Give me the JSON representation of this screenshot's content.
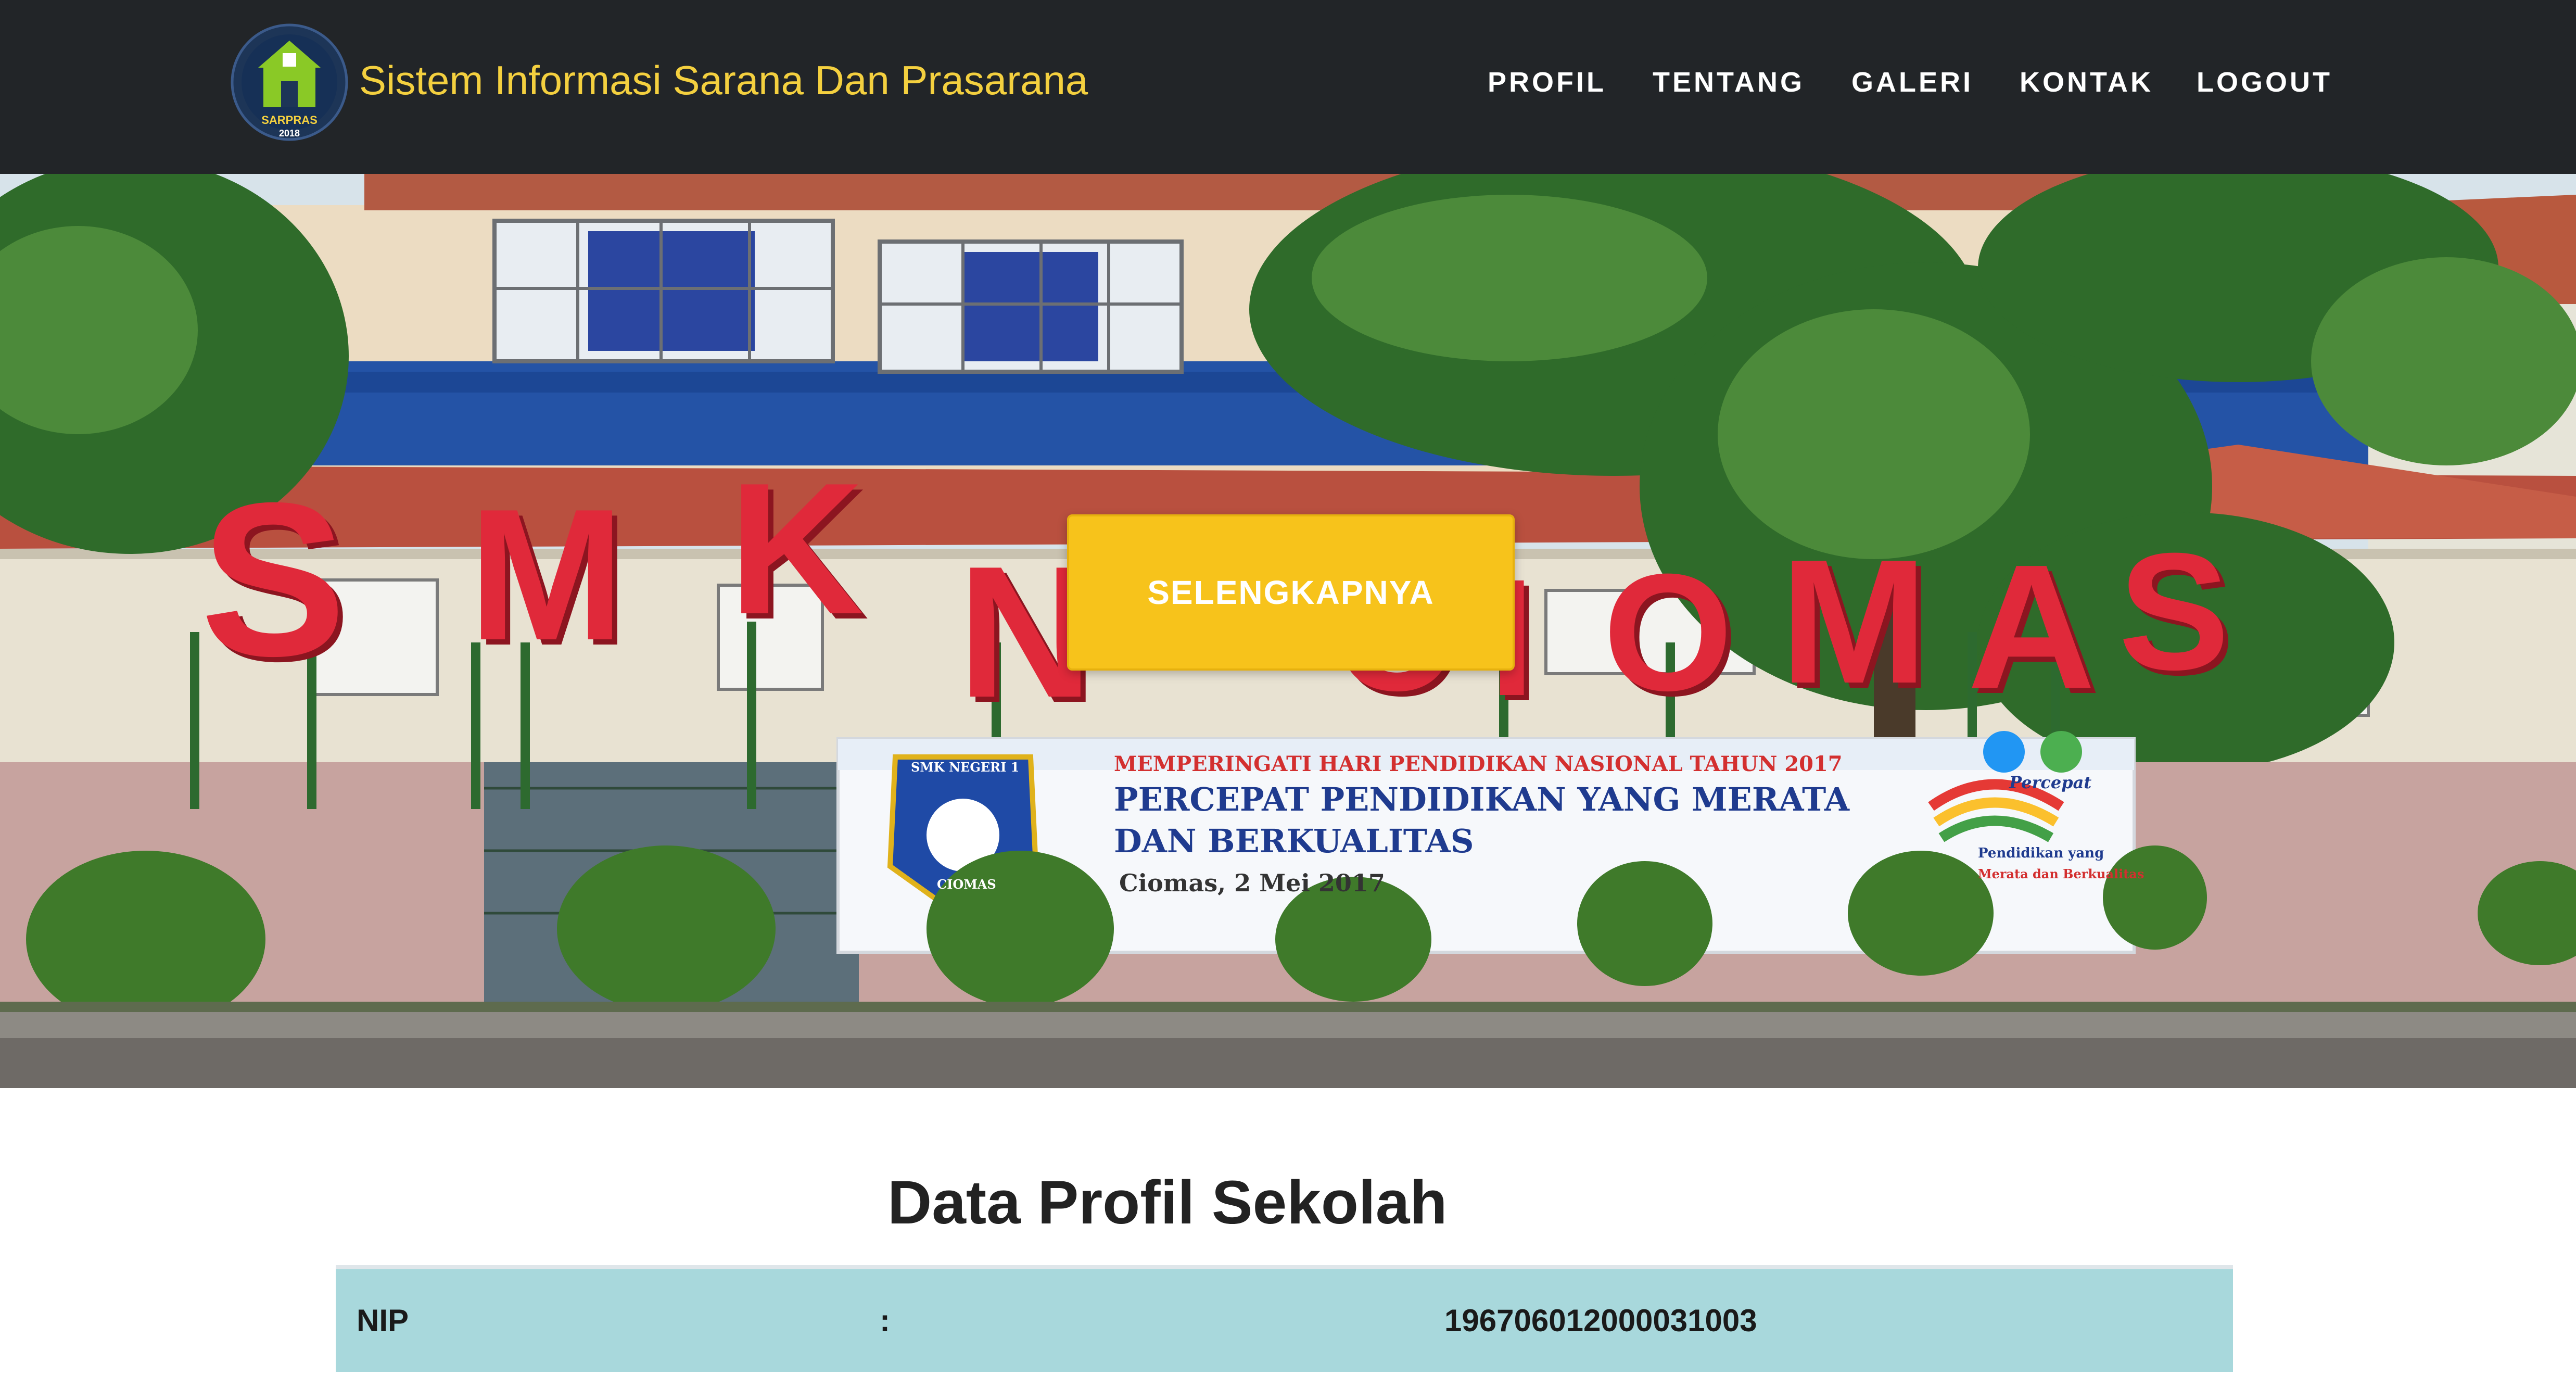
{
  "app": {
    "title": "Sistem Informasi Sarana Dan Prasarana",
    "logo_text_top": "SARPRAS",
    "logo_text_bottom": "2018"
  },
  "nav": {
    "items": [
      {
        "label": "PROFIL"
      },
      {
        "label": "TENTANG"
      },
      {
        "label": "GALERI"
      },
      {
        "label": "KONTAK"
      },
      {
        "label": "LOGOUT"
      }
    ]
  },
  "hero": {
    "button_label": "SELENGKAPNYA",
    "sign_letters": [
      "S",
      "M",
      "K",
      "N",
      "C",
      "I",
      "O",
      "M",
      "A",
      "S"
    ],
    "banner": {
      "line1": "MEMPERINGATI HARI PENDIDIKAN NASIONAL TAHUN 2017",
      "line2": "PERCEPAT PENDIDIKAN YANG MERATA",
      "line3": "DAN BERKUALITAS",
      "line4": "Ciomas, 2 Mei 2017",
      "badge_top": "SMK NEGERI 1",
      "badge_bottom": "CIOMAS",
      "slogan1": "Percepat",
      "slogan2": "Pendidikan yang",
      "slogan3": "Merata dan Berkualitas"
    }
  },
  "content": {
    "section_title": "Data Profil Sekolah",
    "rows": [
      {
        "label": "NIP",
        "separator": ":",
        "value": "196706012000031003"
      }
    ]
  },
  "colors": {
    "navbar_bg": "#222528",
    "brand_text": "#f4d03f",
    "cta_bg": "#f7c31b",
    "row_bg": "#a8d8dc"
  }
}
